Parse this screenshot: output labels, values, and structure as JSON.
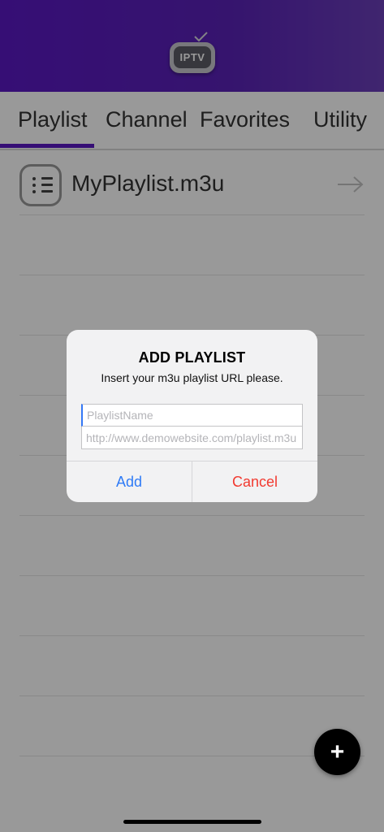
{
  "header": {
    "logo_text": "IPTV",
    "logo_icon": "iptv-tv-icon"
  },
  "tabs": [
    {
      "label": "Playlist",
      "active": true
    },
    {
      "label": "Channel",
      "active": false
    },
    {
      "label": "Favorites",
      "active": false
    },
    {
      "label": "Utility",
      "active": false
    }
  ],
  "playlists": [
    {
      "name": "MyPlaylist.m3u",
      "icon": "list-icon",
      "action_icon": "arrow-right-icon"
    }
  ],
  "dialog": {
    "title": "ADD PLAYLIST",
    "message": "Insert your m3u playlist URL please.",
    "name_placeholder": "PlaylistName",
    "name_value": "",
    "url_placeholder": "http://www.demowebsite.com/playlist.m3u",
    "url_value": "",
    "add_label": "Add",
    "cancel_label": "Cancel"
  },
  "fab": {
    "label": "+",
    "icon": "plus-icon"
  },
  "colors": {
    "accent": "#5a18c4",
    "add": "#2f7bf6",
    "cancel": "#f23a30"
  }
}
